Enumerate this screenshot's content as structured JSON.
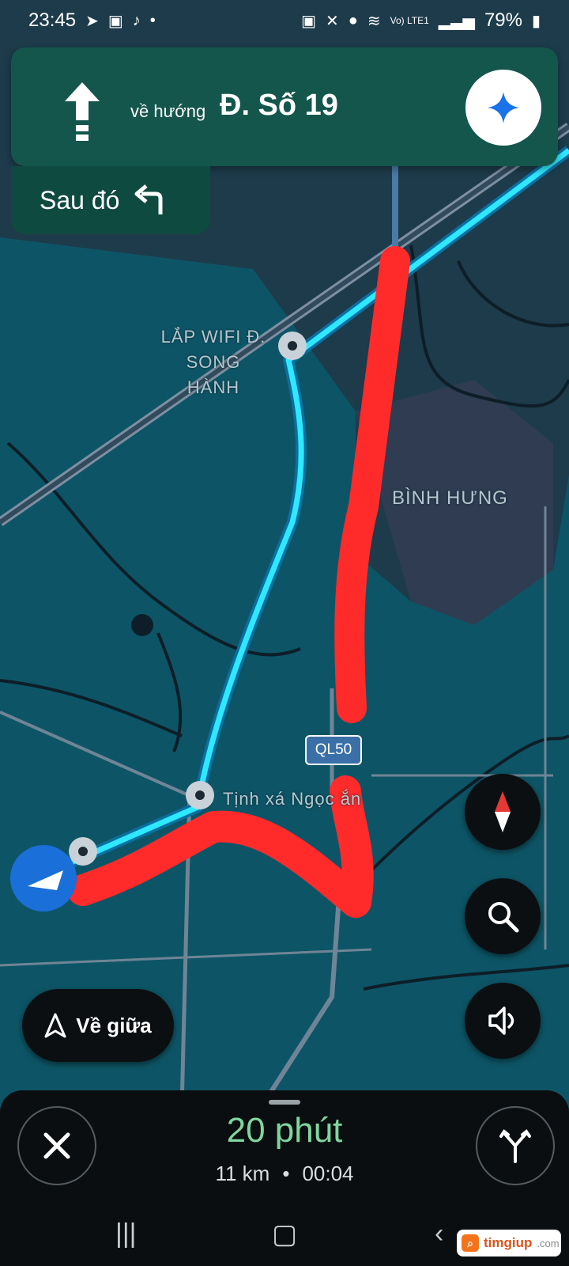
{
  "status_bar": {
    "time": "23:45",
    "left_icons": [
      "navigation-icon",
      "gallery-icon",
      "tiktok-icon",
      "dot-icon"
    ],
    "network_label": "Vo) LTE1",
    "battery": "79%"
  },
  "navigation": {
    "toward_label": "về hướng",
    "street": "Đ. Số 19",
    "maneuver": "straight",
    "then_label": "Sau đó",
    "then_maneuver": "turn-left"
  },
  "map": {
    "labels": {
      "wifi": "LẮP WIFI Đ. SONG HÀNH",
      "area": "BÌNH HƯNG",
      "place": "Tịnh xá Ngọc ắn",
      "shield": "QL50"
    },
    "colors": {
      "route": "#2ee8ff",
      "annotation": "#ff2b2b",
      "water": "#0e5566"
    }
  },
  "controls": {
    "recenter_label": "Về giữa"
  },
  "trip": {
    "duration": "20 phút",
    "distance": "11 km",
    "arrival": "00:04",
    "separator": "•"
  },
  "watermark": {
    "brand": "timgiup",
    "domain": ".com"
  }
}
